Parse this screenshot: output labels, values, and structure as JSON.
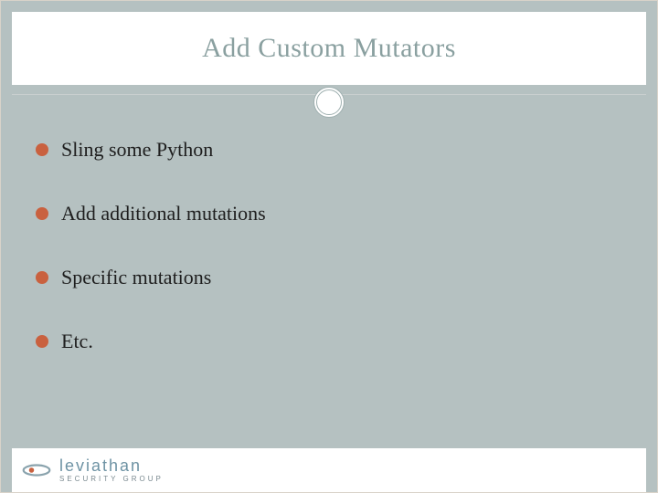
{
  "title": "Add Custom Mutators",
  "bullets": [
    "Sling some Python",
    "Add additional mutations",
    "Specific mutations",
    "Etc."
  ],
  "logo": {
    "name": "leviathan",
    "sub": "SECURITY GROUP"
  },
  "colors": {
    "background": "#b5c1c1",
    "title": "#8aa0a0",
    "bullet": "#c9613f",
    "logo": "#6e93a4"
  }
}
